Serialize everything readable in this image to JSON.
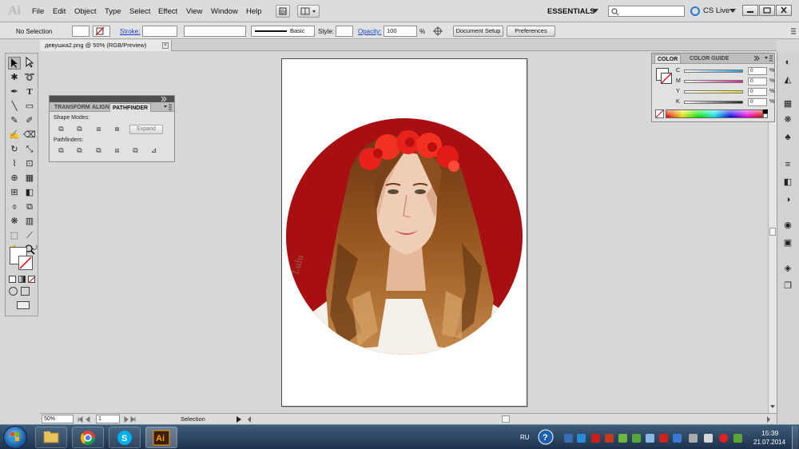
{
  "app": {
    "logo": "Ai",
    "workspace": "ESSENTIALS",
    "cs_live": "CS Live"
  },
  "menu": [
    "File",
    "Edit",
    "Object",
    "Type",
    "Select",
    "Effect",
    "View",
    "Window",
    "Help"
  ],
  "control_bar": {
    "selection_status": "No Selection",
    "stroke_label": "Stroke:",
    "brush_label": "Basic",
    "style_label": "Style:",
    "opacity_label": "Opacity:",
    "opacity_value": "100",
    "opacity_unit": "%",
    "document_setup": "Document Setup",
    "preferences": "Preferences"
  },
  "document": {
    "tab_title": "девушка2.png @ 50% (RGB/Preview)",
    "close": "×"
  },
  "status_bar": {
    "zoom": "50%",
    "artboard": "1",
    "tool": "Selection"
  },
  "pathfinder_panel": {
    "tabs": [
      "TRANSFORM",
      "ALIGN",
      "PATHFINDER"
    ],
    "shape_modes_label": "Shape Modes:",
    "pathfinders_label": "Pathfinders:",
    "expand": "Expand"
  },
  "color_panel": {
    "tabs": [
      "COLOR",
      "COLOR GUIDE"
    ],
    "channels": [
      {
        "label": "C",
        "value": "0",
        "unit": "%",
        "color": "#2a9fd6"
      },
      {
        "label": "M",
        "value": "0",
        "unit": "%",
        "color": "#d6208a"
      },
      {
        "label": "Y",
        "value": "0",
        "unit": "%",
        "color": "#e8e020"
      },
      {
        "label": "K",
        "value": "0",
        "unit": "%",
        "color": "#222222"
      }
    ]
  },
  "taskbar": {
    "language": "RU",
    "time": "15:39",
    "date": "21.07.2014"
  },
  "colors": {
    "artwork_red": "#a80f12",
    "hair": "#8a4a1a",
    "flowers": "#e8211c"
  }
}
